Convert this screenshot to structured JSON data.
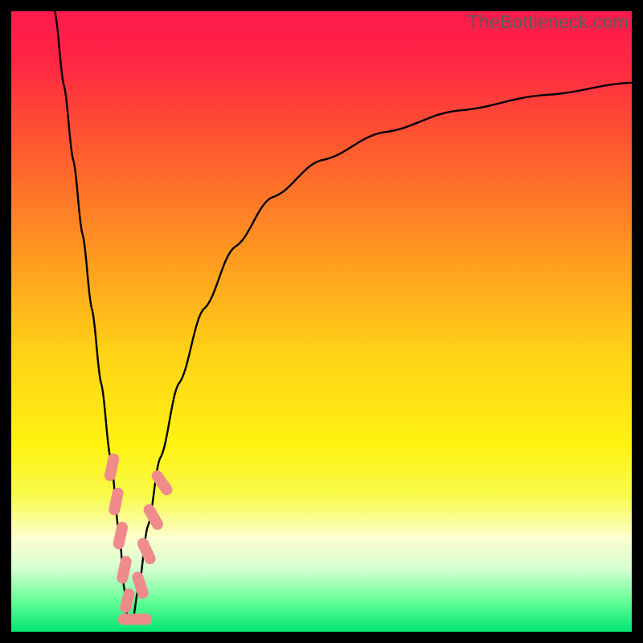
{
  "watermark": "TheBottleneck.com",
  "chart_data": {
    "type": "line",
    "title": "",
    "xlabel": "",
    "ylabel": "",
    "xlim": [
      0,
      100
    ],
    "ylim": [
      0,
      100
    ],
    "gradient_stops": [
      {
        "offset": 0,
        "color": "#ff1a4d"
      },
      {
        "offset": 0.08,
        "color": "#ff2644"
      },
      {
        "offset": 0.22,
        "color": "#ff5a2f"
      },
      {
        "offset": 0.38,
        "color": "#ff9421"
      },
      {
        "offset": 0.55,
        "color": "#ffd216"
      },
      {
        "offset": 0.7,
        "color": "#fff312"
      },
      {
        "offset": 0.78,
        "color": "#f8fb4a"
      },
      {
        "offset": 0.85,
        "color": "#fcffd0"
      },
      {
        "offset": 0.9,
        "color": "#d4ffd0"
      },
      {
        "offset": 0.95,
        "color": "#66ff97"
      },
      {
        "offset": 1.0,
        "color": "#00e672"
      }
    ],
    "series": [
      {
        "name": "left-branch",
        "x": [
          7.0,
          8.5,
          10.0,
          11.5,
          13.0,
          14.5,
          16.0,
          17.5,
          18.2,
          18.8
        ],
        "y": [
          100,
          88,
          76,
          64,
          52,
          40,
          28,
          15,
          7,
          1.5
        ]
      },
      {
        "name": "right-branch",
        "x": [
          19.5,
          20.5,
          22.0,
          24.0,
          27.0,
          31.0,
          36.0,
          42.0,
          50.0,
          60.0,
          72.0,
          86.0,
          100.0
        ],
        "y": [
          1.5,
          7,
          17,
          28,
          40,
          52,
          62,
          70,
          76,
          80.5,
          84,
          86.5,
          88.5
        ]
      }
    ],
    "markers": {
      "name": "highlight-dots",
      "color": "#ef8b8b",
      "points": [
        {
          "x": 16.2,
          "y": 26.5,
          "len": 4.5,
          "angle": -78
        },
        {
          "x": 16.9,
          "y": 21.0,
          "len": 4.5,
          "angle": -78
        },
        {
          "x": 17.6,
          "y": 15.5,
          "len": 4.5,
          "angle": -78
        },
        {
          "x": 18.2,
          "y": 10.0,
          "len": 4.5,
          "angle": -78
        },
        {
          "x": 18.7,
          "y": 5.0,
          "len": 4.0,
          "angle": -75
        },
        {
          "x": 19.2,
          "y": 2.0,
          "len": 4.0,
          "angle": 0
        },
        {
          "x": 21.2,
          "y": 2.0,
          "len": 3.0,
          "angle": 0
        },
        {
          "x": 20.8,
          "y": 7.5,
          "len": 4.5,
          "angle": 72
        },
        {
          "x": 21.8,
          "y": 13.0,
          "len": 4.5,
          "angle": 65
        },
        {
          "x": 22.9,
          "y": 18.5,
          "len": 4.5,
          "angle": 60
        },
        {
          "x": 24.3,
          "y": 24.0,
          "len": 4.5,
          "angle": 55
        }
      ]
    }
  }
}
